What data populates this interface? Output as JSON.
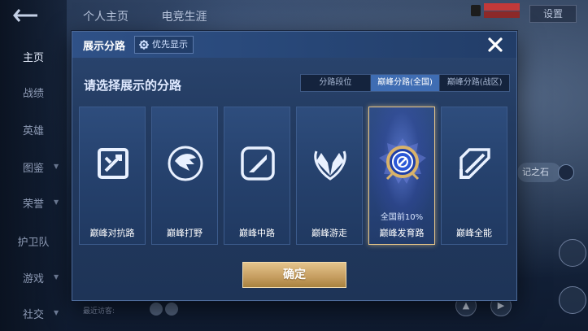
{
  "background": {
    "top_tabs": [
      "个人主页",
      "电竞生涯"
    ],
    "top_right_button": "设置",
    "nav_items": [
      {
        "label": "主页",
        "active": true
      },
      {
        "label": "战绩",
        "active": false
      },
      {
        "label": "英雄",
        "active": false
      },
      {
        "label": "图鉴",
        "active": false
      },
      {
        "label": "荣誉",
        "active": false
      },
      {
        "label": "护卫队",
        "active": false
      },
      {
        "label": "游戏",
        "active": false
      },
      {
        "label": "社交",
        "active": false
      }
    ],
    "visitors_label": "最近访客:",
    "side_pill": "记之石"
  },
  "modal": {
    "title": "展示分路",
    "priority_label": "优先显示",
    "prompt": "请选择展示的分路",
    "tabs": [
      {
        "label": "分路段位",
        "active": false
      },
      {
        "label": "巅峰分路(全国)",
        "active": true
      },
      {
        "label": "巅峰分路(战区)",
        "active": false
      }
    ],
    "cards": [
      {
        "label": "巅峰对抗路",
        "icon": "sword-shield-icon",
        "selected": false,
        "rank": ""
      },
      {
        "label": "巅峰打野",
        "icon": "dragon-icon",
        "selected": false,
        "rank": ""
      },
      {
        "label": "巅峰中路",
        "icon": "slash-icon",
        "selected": false,
        "rank": ""
      },
      {
        "label": "巅峰游走",
        "icon": "wings-icon",
        "selected": false,
        "rank": ""
      },
      {
        "label": "巅峰发育路",
        "icon": "target-emblem-icon",
        "selected": true,
        "rank": "全国前10%"
      },
      {
        "label": "巅峰全能",
        "icon": "crossed-blades-icon",
        "selected": false,
        "rank": ""
      }
    ],
    "confirm_label": "确定"
  },
  "colors": {
    "modal_bg": "#233b61",
    "active_tab": "#3f6db3",
    "selected_border": "#e9c88a",
    "confirm_gold": "#c8a063"
  }
}
